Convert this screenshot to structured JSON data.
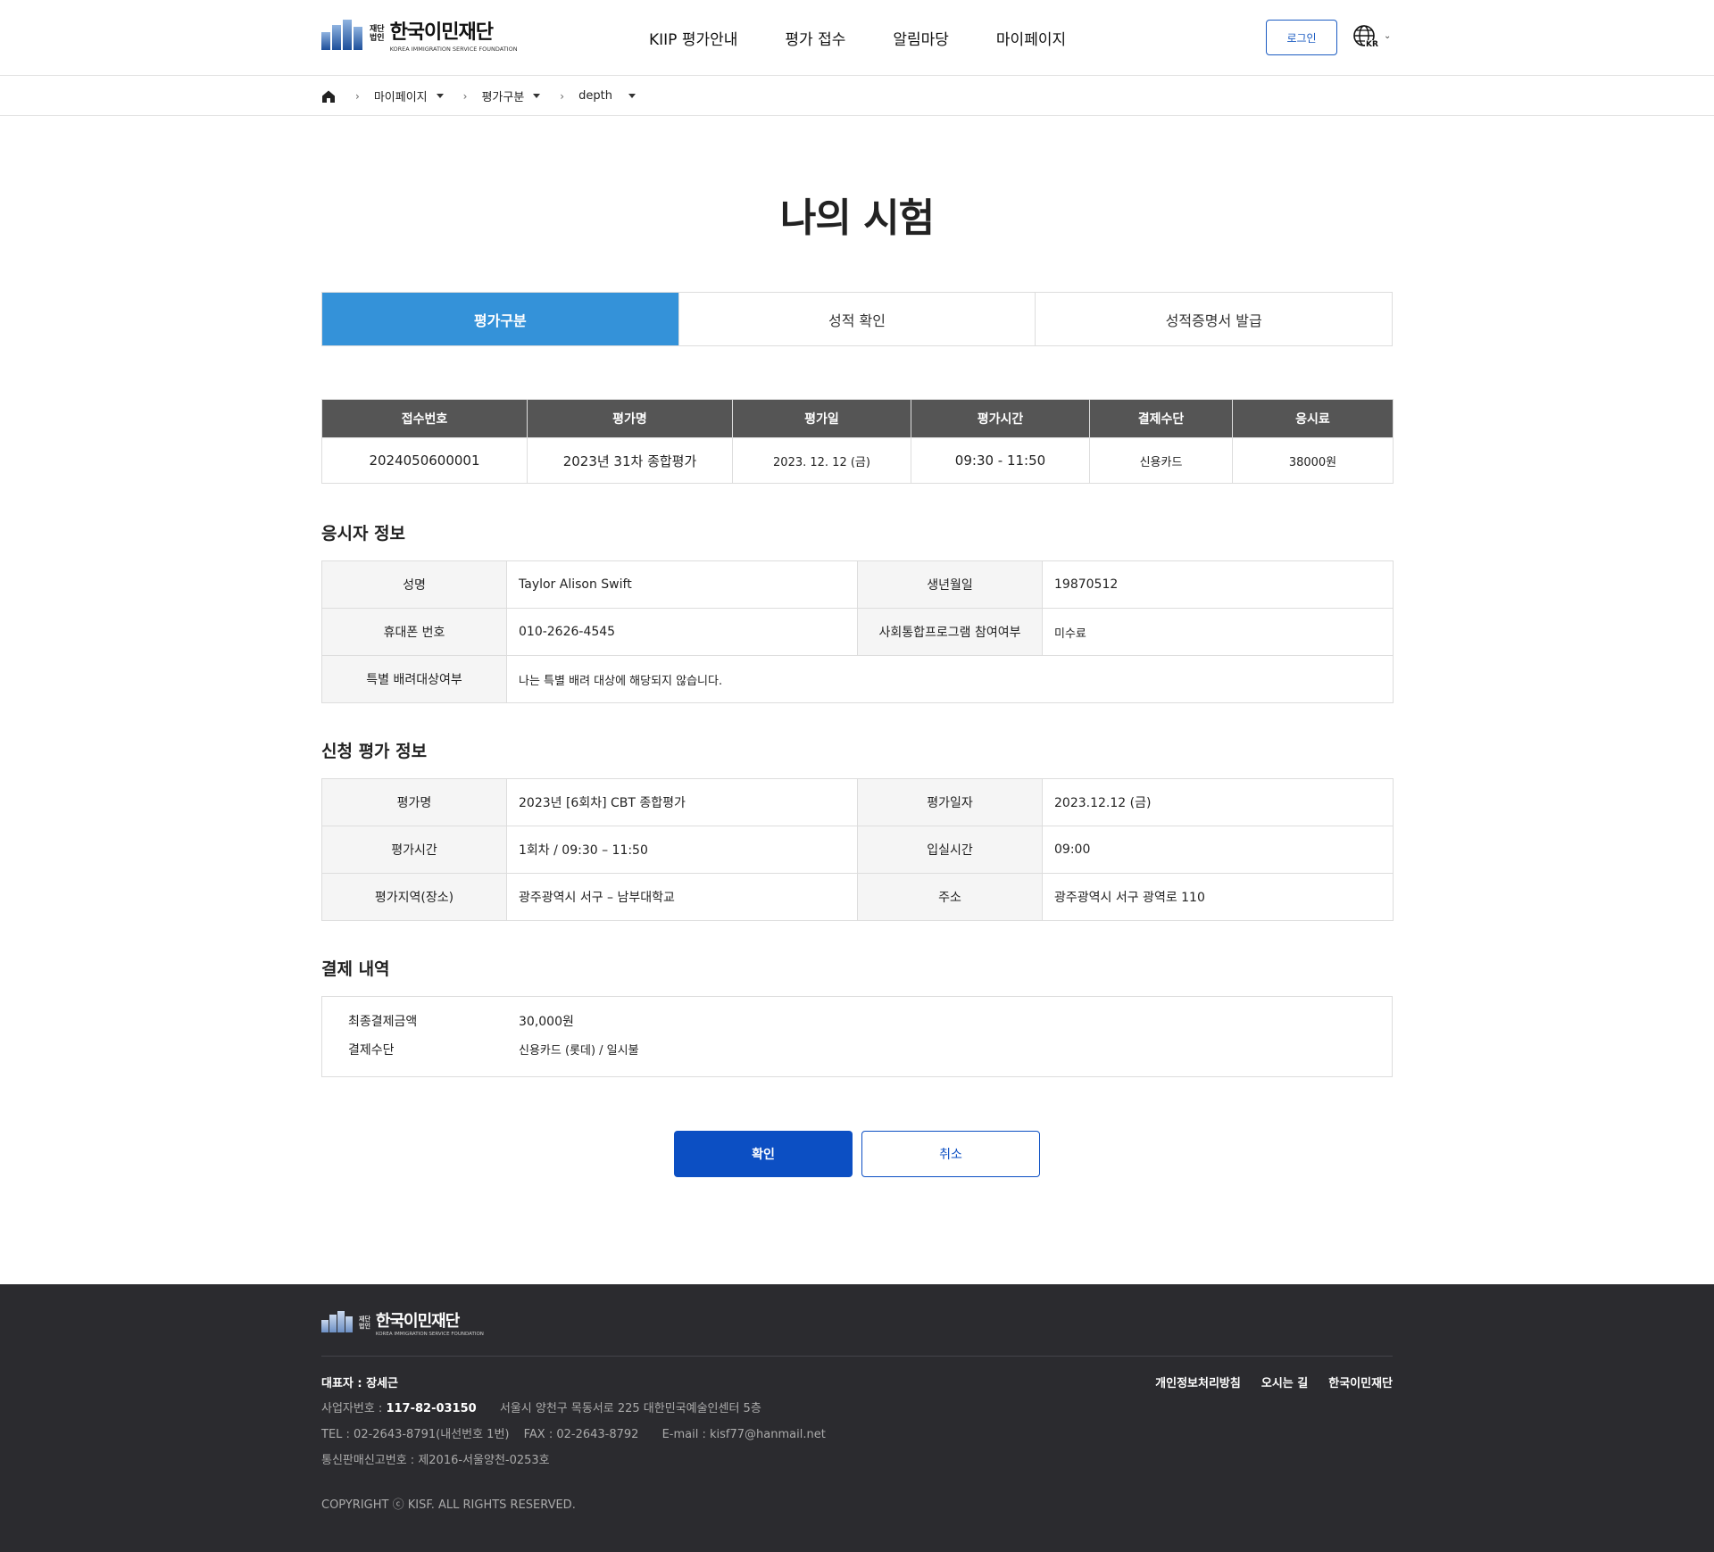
{
  "header": {
    "logo_small_1": "재단",
    "logo_small_2": "법인",
    "logo_name": "한국이민재단",
    "logo_en": "KOREA IMMIGRATION SERVICE FOUNDATION",
    "logo_letters": "KISF",
    "nav": [
      "KIIP 평가안내",
      "평가 접수",
      "알림마당",
      "마이페이지"
    ],
    "login_label": "로그인",
    "lang_label": "KR"
  },
  "breadcrumb": {
    "items": [
      "마이페이지",
      "평가구분",
      "depth"
    ]
  },
  "page_title": "나의 시험",
  "tabs": [
    {
      "label": "평가구분",
      "active": true
    },
    {
      "label": "성적 확인",
      "active": false
    },
    {
      "label": "성적증명서 발급",
      "active": false
    }
  ],
  "summary": {
    "headers": [
      "접수번호",
      "평가명",
      "평가일",
      "평가시간",
      "결제수단",
      "응시료"
    ],
    "row": [
      "2024050600001",
      "2023년 31차 종합평가",
      "2023. 12. 12 (금)",
      "09:30 - 11:50",
      "신용카드",
      "38000원"
    ]
  },
  "applicant": {
    "title": "응시자 정보",
    "name_label": "성명",
    "name": "Taylor Alison Swift",
    "birth_label": "생년월일",
    "birth": "19870512",
    "phone_label": "휴대폰 번호",
    "phone": "010-2626-4545",
    "program_label": "사회통합프로그램 참여여부",
    "program": "미수료",
    "special_label": "특별 배려대상여부",
    "special": "나는 특별 배려 대상에 해당되지 않습니다."
  },
  "exam": {
    "title": "신청 평가 정보",
    "name_label": "평가명",
    "name": "2023년 [6회차] CBT 종합평가",
    "date_label": "평가일자",
    "date": "2023.12.12 (금)",
    "time_label": "평가시간",
    "time": "1회차 / 09:30 – 11:50",
    "entry_label": "입실시간",
    "entry": "09:00",
    "location_label": "평가지역(장소)",
    "location": "광주광역시 서구 – 남부대학교",
    "address_label": "주소",
    "address": "광주광역시 서구 광역로 110"
  },
  "payment": {
    "title": "결제 내역",
    "amount_label": "최종결제금액",
    "amount": "30,000원",
    "method_label": "결제수단",
    "method": "신용카드 (롯데) / 일시불"
  },
  "buttons": {
    "confirm": "확인",
    "cancel": "취소"
  },
  "footer": {
    "logo_small_1": "재단",
    "logo_small_2": "법인",
    "logo_name": "한국이민재단",
    "logo_en": "KOREA IMMIGRATION SERVICE FOUNDATION",
    "logo_letters": "KISF",
    "rep": "대표자 : 장세근",
    "biz_label": "사업자번호 : ",
    "biz_no": "117-82-03150",
    "address": "서울시 양천구 목동서로 225 대한민국예술인센터 5층",
    "tel": "TEL : 02-2643-8791(내선번호 1번)",
    "fax": "FAX : 02-2643-8792",
    "email": "E-mail : kisf77@hanmail.net",
    "mail_order": "통신판매신고번호 : 제2016-서울양천-0253호",
    "copyright": "COPYRIGHT ⓒ KISF. ALL RIGHTS RESERVED.",
    "links": [
      "개인정보처리방침",
      "오시는 길",
      "한국이민재단"
    ]
  },
  "colors": {
    "tab_active": "#3492d9",
    "primary": "#0c4fc3",
    "table_header": "#555555",
    "footer_bg": "#2b2b2f"
  }
}
